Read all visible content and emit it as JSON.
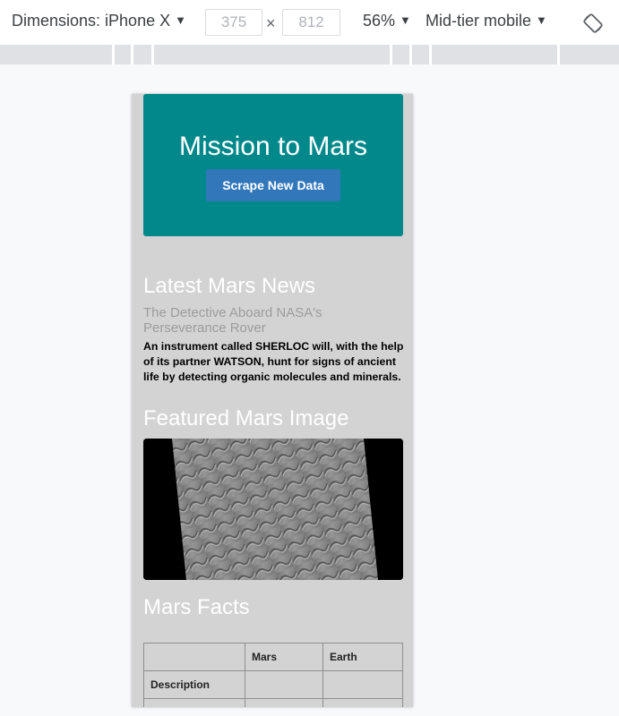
{
  "toolbar": {
    "device_label": "Dimensions: iPhone X",
    "width_value": "375",
    "height_value": "812",
    "times_symbol": "×",
    "zoom": "56%",
    "throttle": "Mid-tier mobile",
    "caret": "▼",
    "rotate_icon": "rotate-device-icon"
  },
  "page": {
    "hero_title": "Mission to Mars",
    "scrape_button": "Scrape New Data",
    "news_heading": "Latest Mars News",
    "news_title": "The Detective Aboard NASA's Perseverance Rover",
    "news_paragraph": "An instrument called SHERLOC will, with the help of its partner WATSON, hunt for signs of ancient life by detecting organic molecules and minerals.",
    "featured_heading": "Featured Mars Image",
    "facts_heading": "Mars Facts",
    "facts_table": {
      "headers": [
        "",
        "Mars",
        "Earth"
      ],
      "rows": [
        [
          "Description",
          "",
          ""
        ]
      ]
    }
  },
  "colors": {
    "hero_bg": "#00888a",
    "button_bg": "#3377bb",
    "page_bg": "#d3d3d3"
  }
}
